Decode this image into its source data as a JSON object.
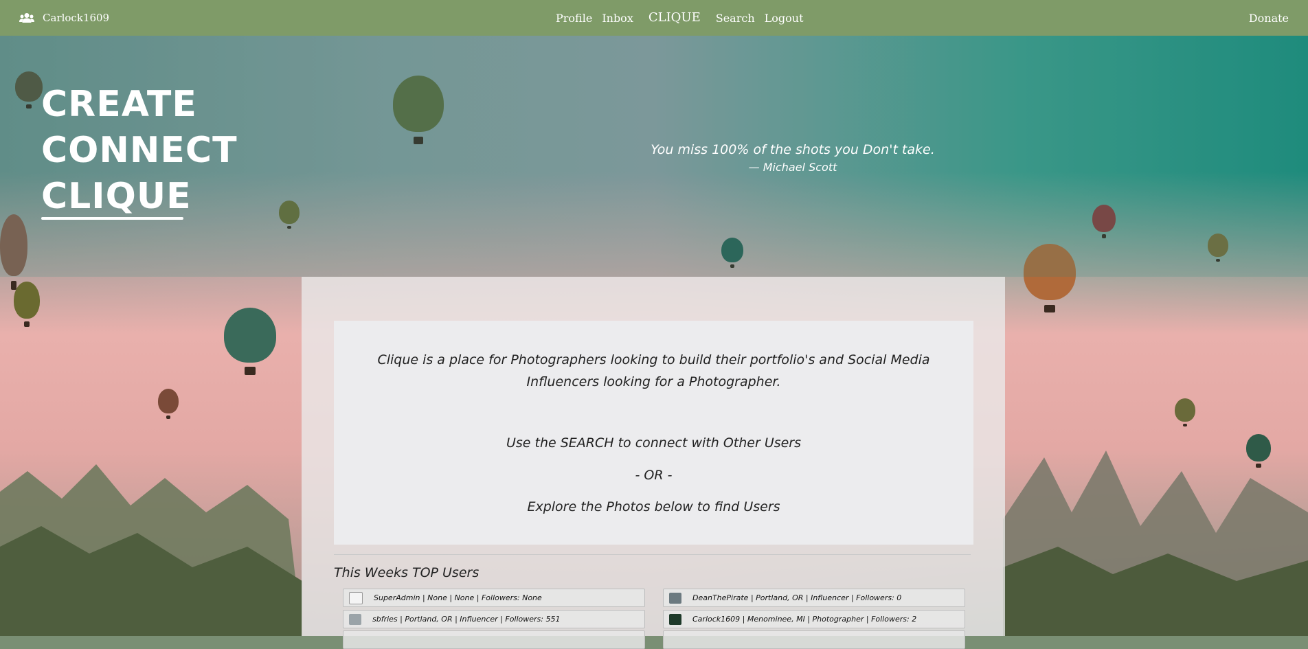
{
  "navbar": {
    "username": "Carlock1609",
    "links": [
      "Profile",
      "Inbox"
    ],
    "brand": "CLIQUE",
    "links_right": [
      "Search",
      "Logout"
    ],
    "donate": "Donate",
    "user_icon": "users-icon"
  },
  "hero": {
    "words": [
      "CREATE",
      "CONNECT",
      "CLIQUE"
    ],
    "quote": "You miss 100% of the shots you Don't take.",
    "attribution": "— Michael Scott"
  },
  "intro": {
    "line1": "Clique is a place for Photographers looking to build their portfolio's and Social Media",
    "line2": "Influencers looking for a Photographer.",
    "line3": "Use the SEARCH to connect with Other Users",
    "line4": "- OR -",
    "line5": "Explore the Photos below to find Users"
  },
  "top_users": {
    "title": "This Weeks TOP Users",
    "users": [
      {
        "text": "SuperAdmin | None | None | Followers: None",
        "thumb_color": "#f4f4f4"
      },
      {
        "text": "DeanThePirate | Portland, OR | Influencer | Followers: 0",
        "thumb_color": "#6c7a80"
      },
      {
        "text": "sbfries | Portland, OR | Influencer | Followers: 551",
        "thumb_color": "#9aa3a8"
      },
      {
        "text": "Carlock1609 | Menominee, MI | Photographer | Followers: 2",
        "thumb_color": "#1e3a2a"
      }
    ]
  },
  "colors": {
    "navbar": "#7f9b68",
    "panel": "#ececee"
  }
}
